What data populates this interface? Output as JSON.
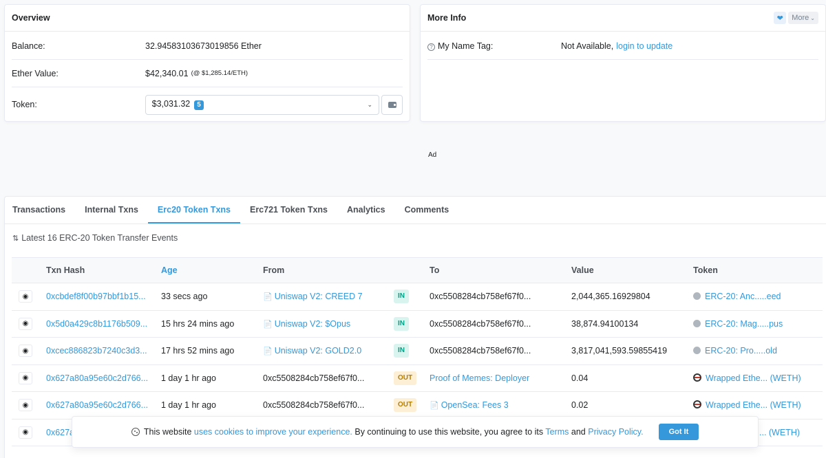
{
  "overview": {
    "title": "Overview",
    "balance_label": "Balance:",
    "balance_value": "32.94583103673019856 Ether",
    "ether_value_label": "Ether Value:",
    "ether_value": "$42,340.01",
    "ether_rate": "(@ $1,285.14/ETH)",
    "token_label": "Token:",
    "token_value": "$3,031.32",
    "token_count": "5"
  },
  "more_info": {
    "title": "More Info",
    "more_label": "More",
    "name_tag_label": "My Name Tag:",
    "name_tag_value": "Not Available,",
    "name_tag_link": "login to update"
  },
  "ad_label": "Ad",
  "tabs": [
    {
      "label": "Transactions"
    },
    {
      "label": "Internal Txns"
    },
    {
      "label": "Erc20 Token Txns",
      "active": true
    },
    {
      "label": "Erc721 Token Txns"
    },
    {
      "label": "Analytics"
    },
    {
      "label": "Comments"
    }
  ],
  "events_caption": "Latest 16 ERC-20 Token Transfer Events",
  "table": {
    "headers": {
      "txn_hash": "Txn Hash",
      "age": "Age",
      "from": "From",
      "to": "To",
      "value": "Value",
      "token": "Token"
    },
    "rows": [
      {
        "hash": "0xcbdef8f00b97bbf1b15...",
        "age": "33 secs ago",
        "from": "Uniswap V2: CREED 7",
        "dir": "IN",
        "to": "0xc5508284cb758ef67f0...",
        "value": "2,044,365.16929804",
        "token": "ERC-20: Anc.....eed"
      },
      {
        "hash": "0x5d0a429c8b1176b509...",
        "age": "15 hrs 24 mins ago",
        "from": "Uniswap V2: $Opus",
        "dir": "IN",
        "to": "0xc5508284cb758ef67f0...",
        "value": "38,874.94100134",
        "token": "ERC-20: Mag.....pus"
      },
      {
        "hash": "0xcec886823b7240c3d3...",
        "age": "17 hrs 52 mins ago",
        "from": "Uniswap V2: GOLD2.0",
        "dir": "IN",
        "to": "0xc5508284cb758ef67f0...",
        "value": "3,817,041,593.59855419",
        "token": "ERC-20: Pro.....old"
      },
      {
        "hash": "0x627a80a95e60c2d766...",
        "age": "1 day 1 hr ago",
        "from": "0xc5508284cb758ef67f0...",
        "dir": "OUT",
        "to": "Proof of Memes: Deployer",
        "value": "0.04",
        "token": "Wrapped Ethe... (WETH)"
      },
      {
        "hash": "0x627a80a95e60c2d766...",
        "age": "1 day 1 hr ago",
        "from": "0xc5508284cb758ef67f0...",
        "dir": "OUT",
        "to": "OpenSea: Fees 3",
        "value": "0.02",
        "token": "Wrapped Ethe... (WETH)"
      },
      {
        "hash": "0x627a",
        "age": "",
        "from": "",
        "dir": "",
        "to": "",
        "value": "",
        "token": "... (WETH)"
      }
    ]
  },
  "cookie": {
    "prefix": "This website",
    "link1": "uses cookies to improve your experience.",
    "middle": "By continuing to use this website, you agree to its",
    "link2": "Terms",
    "and": "and",
    "link3": "Privacy Policy.",
    "button": "Got It"
  }
}
